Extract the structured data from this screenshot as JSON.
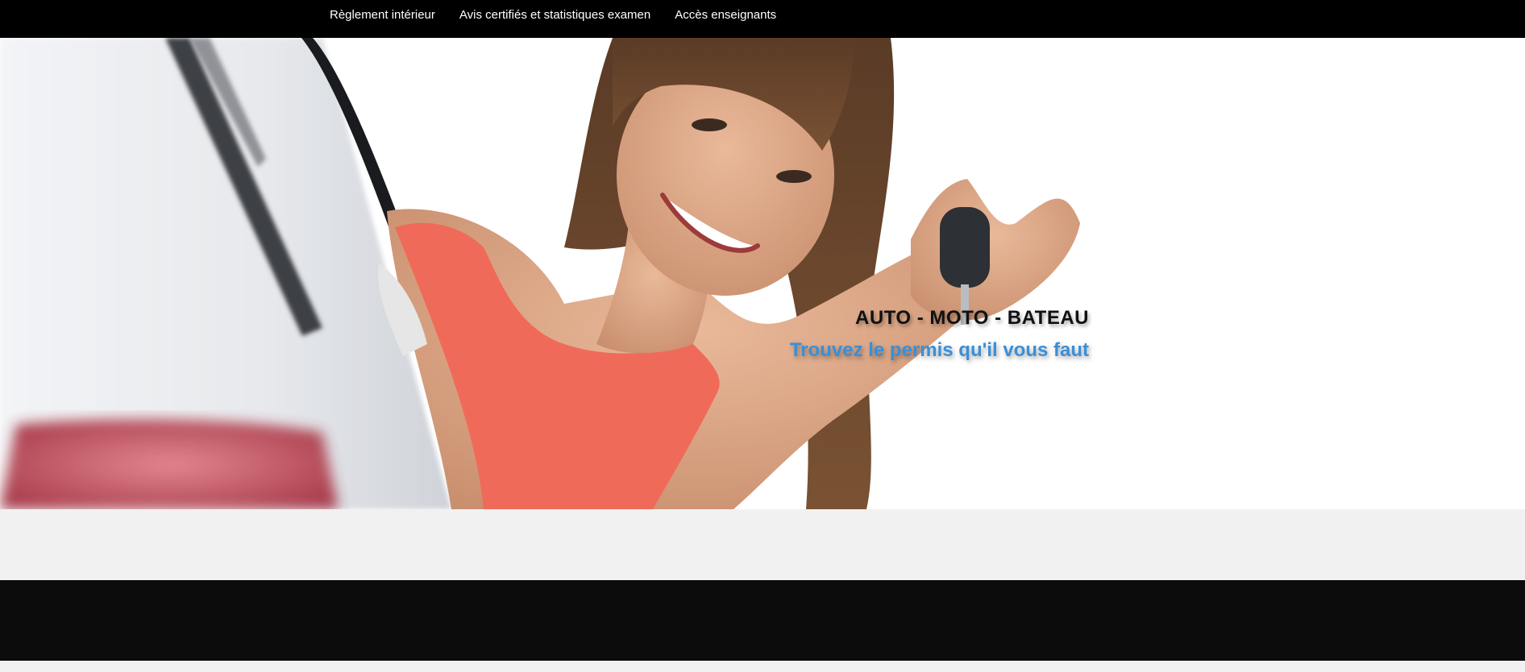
{
  "nav": {
    "items": [
      {
        "label": "Règlement intérieur"
      },
      {
        "label": "Avis certifiés et statistiques examen"
      },
      {
        "label": "Accès enseignants"
      }
    ]
  },
  "hero": {
    "headline": "AUTO - MOTO - BATEAU",
    "subheadline": "Trouvez le permis qu'il vous faut",
    "image_description_icon": "woman-with-car-keys-photo"
  },
  "colors": {
    "nav_bg": "#000000",
    "accent": "#3a8fd6",
    "footer_bg": "#0c0c0c",
    "page_bg": "#f1f1f1"
  }
}
